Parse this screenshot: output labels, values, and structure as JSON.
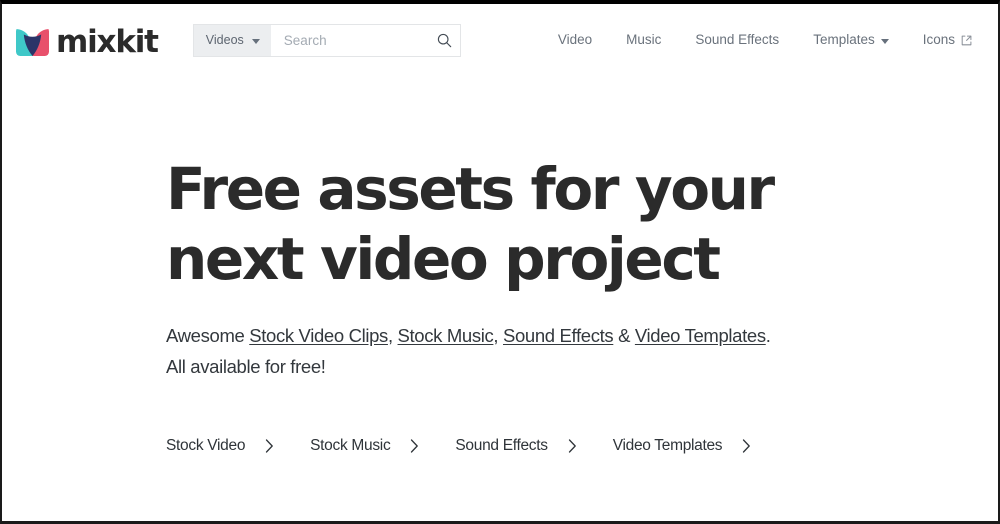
{
  "brand": {
    "name": "mixkit",
    "logo_icon": "mixkit-logo-icon",
    "colors": {
      "teal": "#3fc8c8",
      "pink": "#e8506b",
      "navy": "#2b3468",
      "text_dark": "#2b2b2b"
    }
  },
  "search": {
    "scope_label": "Videos",
    "scope_caret_icon": "chevron-down-icon",
    "placeholder": "Search",
    "value": "",
    "submit_icon": "search-icon"
  },
  "nav": {
    "items": [
      {
        "label": "Video",
        "icon": ""
      },
      {
        "label": "Music",
        "icon": ""
      },
      {
        "label": "Sound Effects",
        "icon": ""
      },
      {
        "label": "Templates",
        "icon": "chevron-down-icon"
      },
      {
        "label": "Icons",
        "icon": "external-link-icon"
      }
    ]
  },
  "hero": {
    "headline_line1": "Free assets for your",
    "headline_line2": "next video project",
    "subtitle": {
      "lead": "Awesome ",
      "link1": "Stock Video Clips",
      "sep1": ", ",
      "link2": "Stock Music",
      "sep2": ", ",
      "link3": "Sound Effects",
      "sep3": " & ",
      "link4": "Video Templates",
      "tail": ".",
      "line2": "All available for free!"
    }
  },
  "quicklinks": {
    "chevron_icon": "chevron-right-icon",
    "items": [
      {
        "label": "Stock Video"
      },
      {
        "label": "Stock Music"
      },
      {
        "label": "Sound Effects"
      },
      {
        "label": "Video Templates"
      }
    ]
  }
}
